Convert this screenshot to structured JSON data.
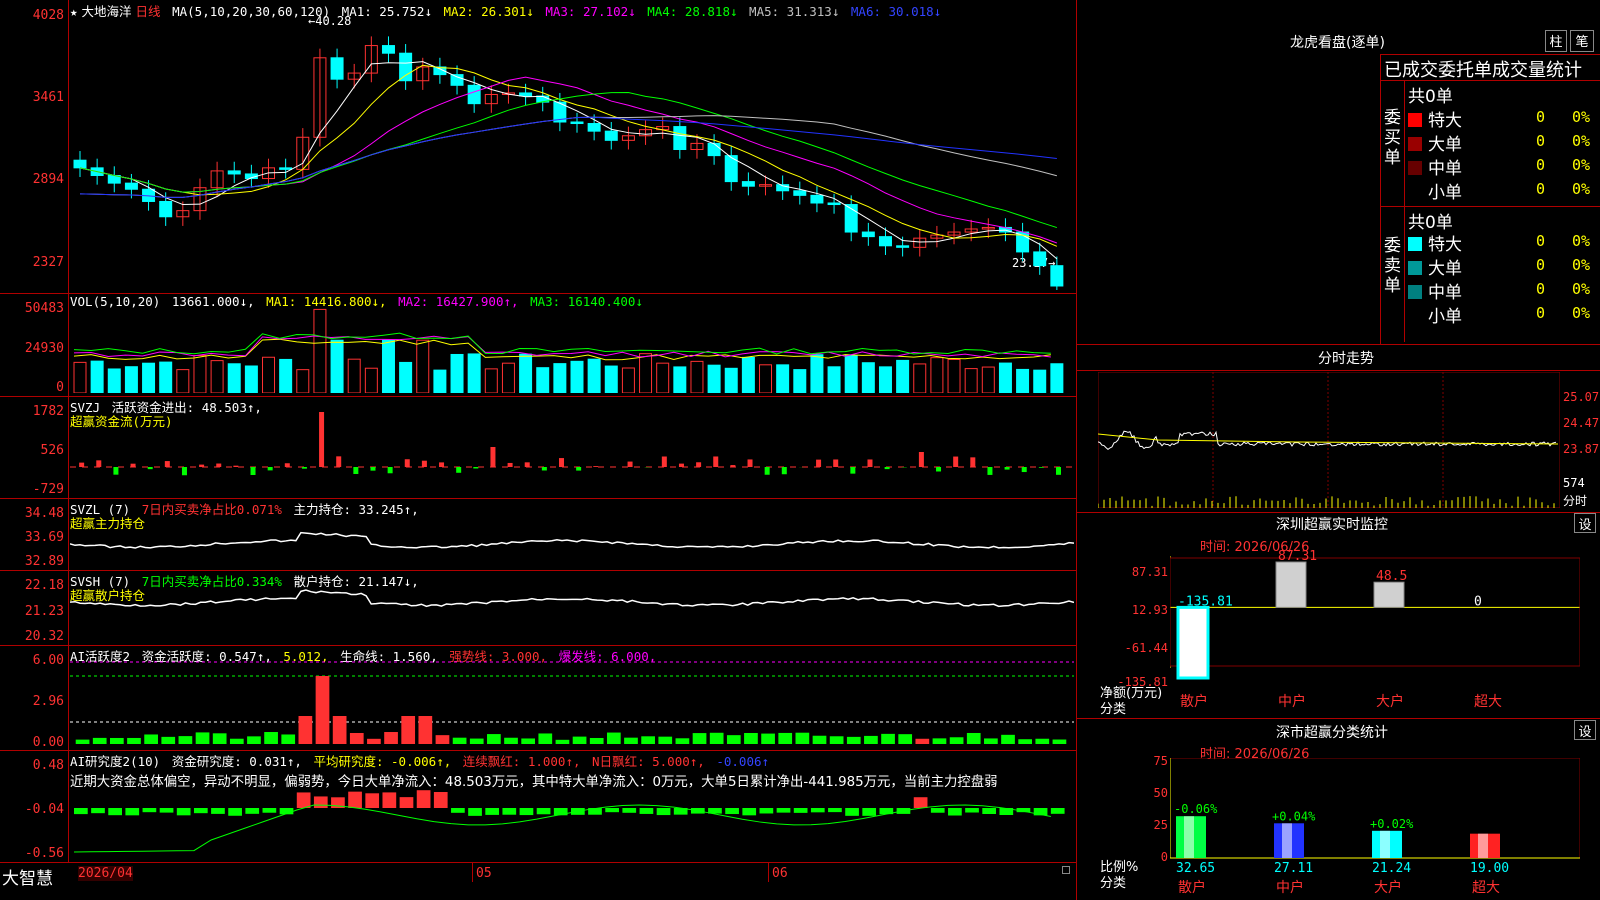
{
  "stock": {
    "star": "★",
    "name": "大地海洋",
    "period": "日线"
  },
  "ma_legend": {
    "label": "MA(5,10,20,30,60,120)",
    "ma1": "MA1: 25.752↓",
    "ma2": "MA2: 26.301↓",
    "ma3": "MA3: 27.102↓",
    "ma4": "MA4: 28.818↓",
    "ma5": "MA5: 31.313↓",
    "ma6": "MA6: 30.018↓"
  },
  "price_axis": [
    "4028",
    "3461",
    "2894",
    "2327"
  ],
  "price_annotations": {
    "high": "40.28",
    "low": "23.27→"
  },
  "vol_legend": {
    "label": "VOL(5,10,20)",
    "value": "13661.000↓,",
    "ma1": "MA1: 14416.800↓,",
    "ma2": "MA2: 16427.900↑,",
    "ma3": "MA3: 16140.400↓"
  },
  "vol_axis": [
    "50483",
    "24930",
    "0"
  ],
  "svzj": {
    "label": "SVZJ",
    "desc": "活跃资金进出: 48.503↑,",
    "title": "超赢资金流(万元)",
    "axis": [
      "1782",
      "526",
      "-729"
    ]
  },
  "svzl": {
    "label": "SVZL (7)",
    "desc1": "7日内买卖净占比0.071%",
    "desc2": "主力持仓: 33.245↑,",
    "title": "超赢主力持仓",
    "axis": [
      "34.48",
      "33.69",
      "32.89"
    ]
  },
  "svsh": {
    "label": "SVSH (7)",
    "desc1": "7日内买卖净占比0.334%",
    "desc2": "散户持仓: 21.147↓,",
    "title": "超赢散户持仓",
    "axis": [
      "22.18",
      "21.23",
      "20.32"
    ]
  },
  "ai_active": {
    "label": "AI活跃度2",
    "desc": "资金活跃度: 0.547↑,",
    "v2": "5.012,",
    "life": "生命线: 1.560,",
    "strong": "强势线: 3.000,",
    "burst": "爆发线: 6.000,",
    "axis": [
      "6.00",
      "2.96",
      "0.00"
    ]
  },
  "ai_research": {
    "label": "AI研究度2(10)",
    "desc": "资金研究度: 0.031↑,",
    "avg": "平均研究度: -0.006↑,",
    "lianxu": "连续飘红: 1.000↑,",
    "nday": "N日飘红: 5.000↑,",
    "last": "-0.006↑",
    "axis": [
      "0.48",
      "-0.04",
      "-0.56"
    ],
    "commentary": "近期大资金总体偏空，异动不明显，偏弱势，今日大单净流入：48.503万元，其中特大单净流入：0万元，大单5日累计净出-441.985万元，当前主力控盘弱"
  },
  "bottom_bar": {
    "brand": "大智慧",
    "dates": [
      "2026/04",
      "05",
      "06"
    ]
  },
  "dragon": {
    "title": "龙虎看盘(逐单)",
    "btn_bar": "柱",
    "btn_pen": "笔",
    "header": "已成交委托单成交量统计",
    "buy_total": "共0单",
    "sell_total": "共0单",
    "buy_label": "委买单",
    "sell_label": "委卖单",
    "buy_rows": [
      {
        "label": "特大",
        "count": "0",
        "pct": "0%",
        "color": "#ff0000"
      },
      {
        "label": "大单",
        "count": "0",
        "pct": "0%",
        "color": "#990000"
      },
      {
        "label": "中单",
        "count": "0",
        "pct": "0%",
        "color": "#660000"
      },
      {
        "label": "小单",
        "count": "0",
        "pct": "0%",
        "color": "#000000"
      }
    ],
    "sell_rows": [
      {
        "label": "特大",
        "count": "0",
        "pct": "0%",
        "color": "#00ffff"
      },
      {
        "label": "大单",
        "count": "0",
        "pct": "0%",
        "color": "#009999"
      },
      {
        "label": "中单",
        "count": "0",
        "pct": "0%",
        "color": "#008080"
      },
      {
        "label": "小单",
        "count": "0",
        "pct": "0%",
        "color": "#000000"
      }
    ]
  },
  "intraday": {
    "title": "分时走势",
    "axis": [
      "25.07",
      "24.47",
      "23.87"
    ],
    "vol": "574",
    "unit": "分时"
  },
  "sz_monitor": {
    "title": "深圳超赢实时监控",
    "settings": "设",
    "time": "时间: 2026/06/26",
    "axis": [
      "87.31",
      "12.93",
      "-61.44",
      "-135.81"
    ],
    "y_label": "净额(万元)",
    "x_label": "分类",
    "bars": [
      {
        "cat": "散户",
        "value": -135.81,
        "label": "-135.81"
      },
      {
        "cat": "中户",
        "value": 87.31,
        "label": "87.31"
      },
      {
        "cat": "大户",
        "value": 48.5,
        "label": "48.5"
      },
      {
        "cat": "超大",
        "value": 0,
        "label": "0"
      }
    ]
  },
  "sz_class": {
    "title": "深市超赢分类统计",
    "settings": "设",
    "time": "时间: 2026/06/26",
    "axis": [
      "75",
      "50",
      "25",
      "0"
    ],
    "y_label": "比例%",
    "x_label": "分类",
    "bars": [
      {
        "cat": "散户",
        "value": 32.65,
        "change": "-0.06%",
        "color": "#00ff44"
      },
      {
        "cat": "中户",
        "value": 27.11,
        "change": "+0.04%",
        "color": "#2233ff"
      },
      {
        "cat": "大户",
        "value": 21.24,
        "change": "+0.02%",
        "color": "#00ffff"
      },
      {
        "cat": "超大",
        "value": 19.0,
        "change": "",
        "color": "#ff2222"
      }
    ]
  },
  "chart_data": {
    "type": "candlestick",
    "close_last": 23.27,
    "high": 40.28,
    "ylim": [
      23.27,
      40.28
    ]
  }
}
